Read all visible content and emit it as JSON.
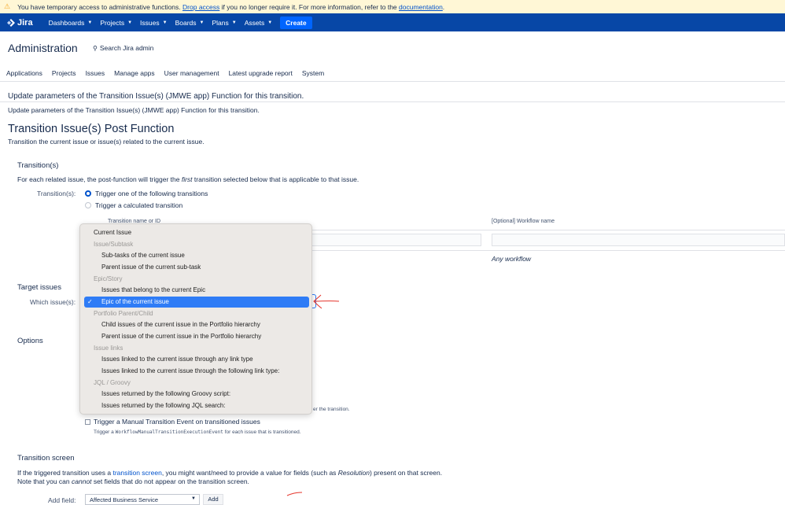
{
  "banner": {
    "text_before": "You have temporary access to administrative functions.",
    "drop_link": "Drop access",
    "text_middle": "if you no longer require it. For more information, refer to the",
    "doc_link": "documentation",
    "text_end": "."
  },
  "nav": {
    "logo": "Jira",
    "items": [
      "Dashboards",
      "Projects",
      "Issues",
      "Boards",
      "Plans",
      "Assets"
    ],
    "create": "Create"
  },
  "admin": {
    "title": "Administration",
    "search": "Search Jira admin",
    "tabs": [
      "Applications",
      "Projects",
      "Issues",
      "Manage apps",
      "User management",
      "Latest upgrade report",
      "System"
    ]
  },
  "header": {
    "update_title": "Update parameters of the Transition Issue(s) (JMWE app) Function for this transition.",
    "update_desc": "Update parameters of the Transition Issue(s) (JMWE app) Function for this transition.",
    "main_title": "Transition Issue(s) Post Function",
    "main_desc": "Transition the current issue or issue(s) related to the current issue."
  },
  "transitions": {
    "heading": "Transition(s)",
    "desc_before": "For each related issue, the post-function will trigger the",
    "desc_em": "first",
    "desc_after": "transition selected below that is applicable to that issue.",
    "label": "Transition(s):",
    "radio1": "Trigger one of the following transitions",
    "radio2": "Trigger a calculated transition",
    "col_name": "Transition name or ID",
    "col_workflow": "[Optional] Workflow name",
    "any_workflow": "Any workflow"
  },
  "target": {
    "heading": "Target issues",
    "label": "Which issue(s):"
  },
  "options": {
    "heading": "Options",
    "partial_hint": "er the transition.",
    "manual_event": "Trigger a Manual Transition Event on transitioned issues",
    "manual_hint_before": "Trigger a",
    "manual_hint_code": "WorkflowManualTransitionExecutionEvent",
    "manual_hint_after": "for each issue that is transitioned."
  },
  "screen": {
    "heading": "Transition screen",
    "line1_before": "If the triggered transition uses a",
    "line1_link": "transition screen",
    "line1_mid": ", you might want/need to provide a value for fields (such as",
    "line1_em": "Resolution",
    "line1_after": ") present on that screen.",
    "line2_before": "Note that you can",
    "line2_em": "cannot",
    "line2_after": "set fields that do not appear on the transition screen.",
    "add_field_label": "Add field:",
    "add_field_value": "Affected Business Service",
    "add_button": "Add"
  },
  "dropdown": {
    "current": "Current Issue",
    "group1": "Issue/Subtask",
    "g1_a": "Sub-tasks of the current issue",
    "g1_b": "Parent issue of the current sub-task",
    "group2": "Epic/Story",
    "g2_a": "Issues that belong to the current Epic",
    "g2_b": "Epic of the current issue",
    "group3": "Portfolio Parent/Child",
    "g3_a": "Child issues of the current issue in the Portfolio hierarchy",
    "g3_b": "Parent issue of the current issue in the Portfolio hierarchy",
    "group4": "Issue links",
    "g4_a": "Issues linked to the current issue through any link type",
    "g4_b": "Issues linked to the current issue through the following link type:",
    "group5": "JQL / Groovy",
    "g5_a": "Issues returned by the following Groovy script:",
    "g5_b": "Issues returned by the following JQL search:",
    "check": "✓"
  },
  "colors": {
    "nav_bg": "#0747a6",
    "create_bg": "#0065ff",
    "selection": "#2f7cf6",
    "annotation": "#e5332a"
  }
}
